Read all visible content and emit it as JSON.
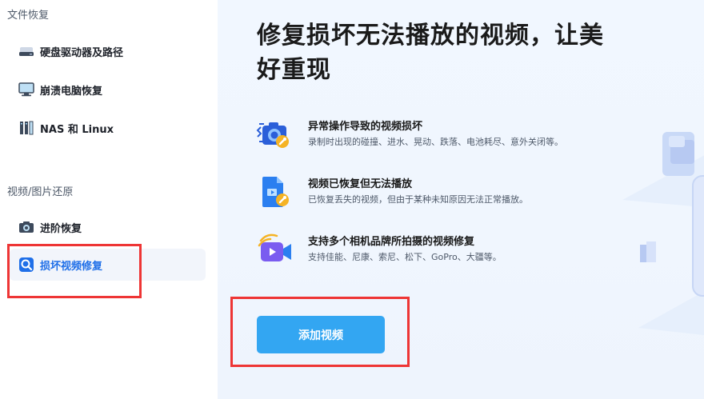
{
  "sidebar": {
    "section1_title": "文件恢复",
    "section1_items": [
      {
        "label": "硬盘驱动器及路径",
        "icon": "hard-drive-icon"
      },
      {
        "label": "崩溃电脑恢复",
        "icon": "monitor-icon"
      },
      {
        "label": "NAS 和 Linux",
        "icon": "nas-server-icon"
      }
    ],
    "section2_title": "视频/图片还原",
    "section2_items": [
      {
        "label": "进阶恢复",
        "icon": "camera-icon"
      },
      {
        "label": "损坏视频修复",
        "icon": "video-repair-icon",
        "active": true
      }
    ]
  },
  "main": {
    "headline": "修复损坏无法播放的视频，让美好重现",
    "features": [
      {
        "title": "异常操作导致的视频损坏",
        "desc": "录制时出现的碰撞、进水、晃动、跌落、电池耗尽、意外关闭等。",
        "icon": "camera-repair-icon"
      },
      {
        "title": "视频已恢复但无法播放",
        "desc": "已恢复丢失的视频，但由于某种未知原因无法正常播放。",
        "icon": "file-repair-icon"
      },
      {
        "title": "支持多个相机品牌所拍摄的视频修复",
        "desc": "支持佳能、尼康、索尼、松下、GoPro、大疆等。",
        "icon": "video-camera-icon"
      }
    ],
    "add_button": "添加视频"
  },
  "colors": {
    "accent": "#1f6fe8",
    "button": "#33a6f2",
    "highlight_box": "#ee3535",
    "main_bg": "#f1f7ff"
  }
}
